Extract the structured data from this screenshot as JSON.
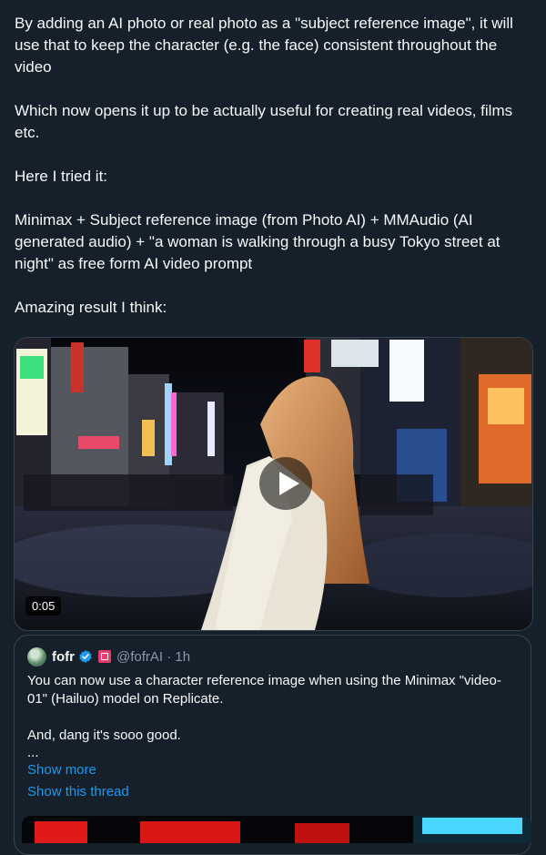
{
  "tweet": {
    "paragraphs": [
      "By adding an AI photo or real photo as a \"subject reference image\", it will use that to keep the character (e.g. the face) consistent throughout the video",
      "Which now opens it up to be actually useful for creating real videos, films etc.",
      "Here I tried it:",
      "Minimax + Subject reference image (from Photo AI) + MMAudio (AI generated audio) + \"a woman is walking through a busy Tokyo street at night\" as free form AI video prompt",
      "Amazing result I think:"
    ]
  },
  "video": {
    "duration": "0:05",
    "icons": {
      "play": "play-icon"
    }
  },
  "quote": {
    "name": "fofr",
    "handle_time": "@fofrAI · 1h",
    "paragraphs": [
      "You can now use a character reference image when using the Minimax \"video-01\" (Hailuo) model on Replicate.",
      "And, dang it's sooo good."
    ],
    "ellipsis": "...",
    "show_more": "Show more",
    "show_thread": "Show this thread",
    "icons": {
      "verified": "verified-badge-icon",
      "affiliate": "affiliate-badge-icon"
    }
  },
  "colors": {
    "background": "#15202b",
    "text": "#f7f9f9",
    "muted": "#8b98a5",
    "link": "#1d9bf0",
    "border": "#38444d"
  }
}
